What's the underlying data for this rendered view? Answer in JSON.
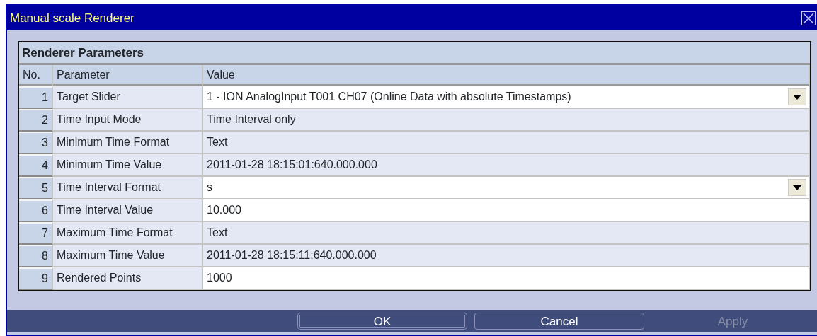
{
  "window": {
    "title": "Manual scale Renderer"
  },
  "panel": {
    "title": "Renderer Parameters"
  },
  "table": {
    "columns": [
      "No.",
      "Parameter",
      "Value"
    ],
    "rows": [
      {
        "no": "1",
        "parameter": "Target Slider",
        "value": "1 - ION AnalogInput T001 CH07 (Online Data with absolute Timestamps)",
        "kind": "dropdown",
        "editable": true
      },
      {
        "no": "2",
        "parameter": "Time Input Mode",
        "value": "Time Interval only",
        "kind": "text",
        "editable": false
      },
      {
        "no": "3",
        "parameter": "Minimum Time Format",
        "value": "Text",
        "kind": "text",
        "editable": false
      },
      {
        "no": "4",
        "parameter": "Minimum Time Value",
        "value": "2011-01-28 18:15:01:640.000.000",
        "kind": "text",
        "editable": false
      },
      {
        "no": "5",
        "parameter": "Time Interval Format",
        "value": "s",
        "kind": "dropdown",
        "editable": true
      },
      {
        "no": "6",
        "parameter": "Time Interval Value",
        "value": "10.000",
        "kind": "text",
        "editable": true
      },
      {
        "no": "7",
        "parameter": "Maximum Time Format",
        "value": "Text",
        "kind": "text",
        "editable": false
      },
      {
        "no": "8",
        "parameter": "Maximum Time Value",
        "value": "2011-01-28 18:15:11:640.000.000",
        "kind": "text",
        "editable": false
      },
      {
        "no": "9",
        "parameter": "Rendered Points",
        "value": "1000",
        "kind": "text",
        "editable": true
      }
    ]
  },
  "buttons": [
    {
      "label": "OK",
      "default": true,
      "disabled": false
    },
    {
      "label": "Cancel",
      "default": false,
      "disabled": false
    },
    {
      "label": "Apply",
      "default": false,
      "disabled": true
    }
  ]
}
